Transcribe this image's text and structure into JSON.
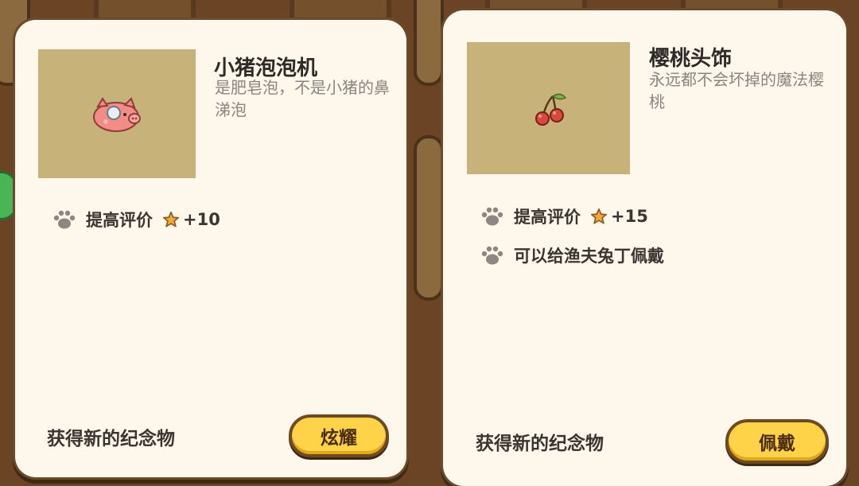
{
  "cards": [
    {
      "title": "小猪泡泡机",
      "description": "是肥皂泡，不是小猪的鼻涕泡",
      "item_icon": "pig-bubble-icon",
      "perks": [
        {
          "icon": "paw-icon",
          "label": "提高评价",
          "bonus_icon": "star-icon",
          "bonus": "+10"
        }
      ],
      "footer": "获得新的纪念物",
      "button": "炫耀"
    },
    {
      "title": "樱桃头饰",
      "description": "永远都不会坏掉的魔法樱桃",
      "item_icon": "cherry-icon",
      "perks": [
        {
          "icon": "paw-icon",
          "label": "提高评价",
          "bonus_icon": "star-icon",
          "bonus": "+15"
        },
        {
          "icon": "paw-icon",
          "label": "可以给渔夫兔丁佩戴"
        }
      ],
      "footer": "获得新的纪念物",
      "button": "佩戴"
    }
  ],
  "colors": {
    "card_bg": "#fdf7ec",
    "thumb_bg": "#c7b27a",
    "button_bg": "#ffd347",
    "button_border": "#6e4a22",
    "wood": "#6b4626"
  }
}
